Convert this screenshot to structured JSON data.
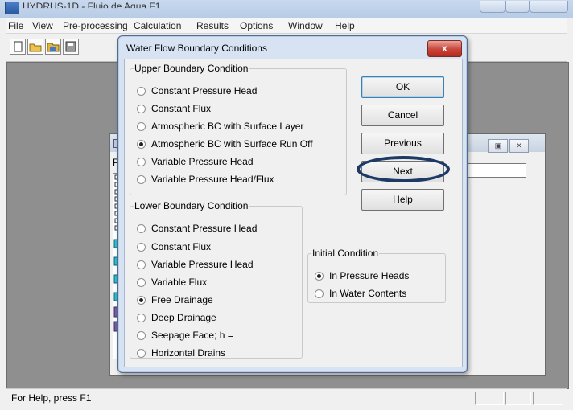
{
  "app": {
    "title": "HYDRUS-1D - Flujo de Agua F1",
    "menu": [
      "File",
      "View",
      "Pre-processing",
      "Calculation",
      "Results",
      "Options",
      "Window",
      "Help"
    ],
    "toolbar_icons": [
      "new-file-icon",
      "open-folder-icon",
      "open-project-icon",
      "save-icon"
    ],
    "status": "For Help, press F1"
  },
  "child_window": {
    "title_partial": "F",
    "label_partial": "Pre-",
    "controls": [
      "restore",
      "close"
    ]
  },
  "dialog": {
    "title": "Water Flow Boundary Conditions",
    "close_label": "x",
    "upper": {
      "legend": "Upper Boundary Condition",
      "options": [
        {
          "label": "Constant Pressure Head",
          "checked": false
        },
        {
          "label": "Constant Flux",
          "checked": false
        },
        {
          "label": "Atmospheric BC with Surface Layer",
          "checked": false
        },
        {
          "label": "Atmospheric BC with Surface Run Off",
          "checked": true
        },
        {
          "label": "Variable Pressure Head",
          "checked": false
        },
        {
          "label": "Variable Pressure Head/Flux",
          "checked": false
        }
      ]
    },
    "lower": {
      "legend": "Lower Boundary Condition",
      "options": [
        {
          "label": "Constant Pressure Head",
          "checked": false
        },
        {
          "label": "Constant Flux",
          "checked": false
        },
        {
          "label": "Variable Pressure Head",
          "checked": false
        },
        {
          "label": "Variable Flux",
          "checked": false
        },
        {
          "label": "Free Drainage",
          "checked": true
        },
        {
          "label": "Deep Drainage",
          "checked": false
        },
        {
          "label": "Seepage Face; h =",
          "checked": false
        },
        {
          "label": "Horizontal Drains",
          "checked": false
        }
      ]
    },
    "initial": {
      "legend": "Initial Condition",
      "options": [
        {
          "label": "In Pressure Heads",
          "checked": true
        },
        {
          "label": "In Water Contents",
          "checked": false
        }
      ]
    },
    "buttons": {
      "ok": "OK",
      "cancel": "Cancel",
      "previous": "Previous",
      "next": "Next",
      "help": "Help"
    }
  }
}
